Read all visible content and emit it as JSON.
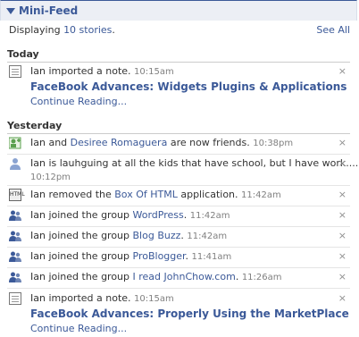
{
  "header": {
    "title": "Mini-Feed"
  },
  "summary": {
    "prefix": "Displaying ",
    "count": "10 stories",
    "suffix": ".",
    "see_all": "See All"
  },
  "sections": {
    "today": "Today",
    "yesterday": "Yesterday"
  },
  "stories": {
    "s1": {
      "text": "Ian imported a note.",
      "time": "10:15am",
      "title": "FaceBook Advances: Widgets Plugins & Applications",
      "continue": "Continue Reading..."
    },
    "s2": {
      "text_a": "Ian and ",
      "link": "Desiree Romaguera",
      "text_b": " are now friends.",
      "time": "10:38pm"
    },
    "s3": {
      "text": "Ian is lauhguing at all the kids that have school, but I have work.........",
      "time": "10:12pm"
    },
    "s4": {
      "text_a": "Ian removed the ",
      "link": "Box Of HTML",
      "text_b": " application.",
      "time": "11:42am"
    },
    "s5": {
      "text_a": "Ian joined the group ",
      "link": "WordPress",
      "text_b": ".",
      "time": "11:42am"
    },
    "s6": {
      "text_a": "Ian joined the group ",
      "link": "Blog Buzz",
      "text_b": ".",
      "time": "11:42am"
    },
    "s7": {
      "text_a": "Ian joined the group ",
      "link": "ProBlogger",
      "text_b": ".",
      "time": "11:41am"
    },
    "s8": {
      "text_a": "Ian joined the group ",
      "link": "I read JohnChow.com",
      "text_b": ".",
      "time": "11:26am"
    },
    "s9": {
      "text": "Ian imported a note.",
      "time": "10:15am",
      "title": "FaceBook Advances: Properly Using the MarketPlace",
      "continue": "Continue Reading..."
    }
  },
  "close_glyph": "×",
  "app_icon_text": "HTML",
  "colors": {
    "link": "#3b5998",
    "header_bg": "#eceff5",
    "time": "#808080",
    "friend_icon": "#5aa04e",
    "person_icon": "#8aa3d1"
  }
}
